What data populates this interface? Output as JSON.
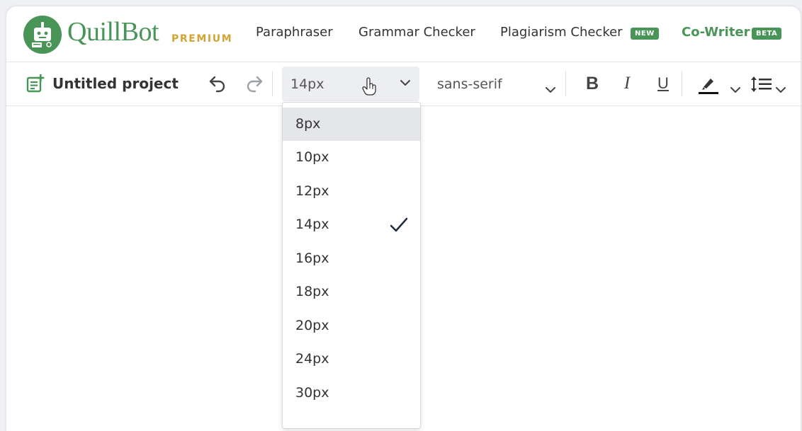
{
  "app": {
    "brand": "QuillBot",
    "tier": "PREMIUM",
    "colors": {
      "green": "#499557",
      "gold": "#d3a434"
    }
  },
  "nav": {
    "items": [
      {
        "label": "Paraphraser"
      },
      {
        "label": "Grammar Checker"
      },
      {
        "label": "Plagiarism Checker",
        "badge": "NEW"
      },
      {
        "label": "Co-Writer",
        "badge": "BETA",
        "active": true
      }
    ]
  },
  "toolbar": {
    "project_title": "Untitled project",
    "font_size": "14px",
    "font_family": "sans-serif",
    "bold": "B",
    "italic": "I",
    "underline": "U"
  },
  "font_size_menu": {
    "options": [
      "8px",
      "10px",
      "12px",
      "14px",
      "16px",
      "18px",
      "20px",
      "24px",
      "30px"
    ],
    "selected": "14px",
    "hovered": "8px"
  }
}
